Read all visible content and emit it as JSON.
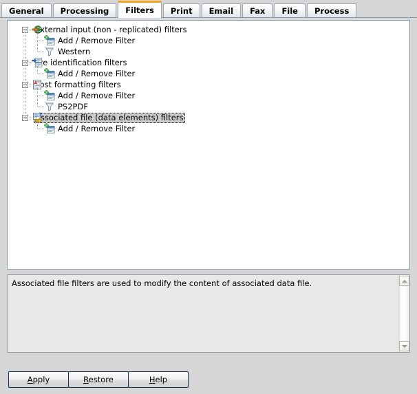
{
  "tabs": [
    {
      "label": "General",
      "active": false
    },
    {
      "label": "Processing",
      "active": false
    },
    {
      "label": "Filters",
      "active": true
    },
    {
      "label": "Print",
      "active": false
    },
    {
      "label": "Email",
      "active": false
    },
    {
      "label": "Fax",
      "active": false
    },
    {
      "label": "File",
      "active": false
    },
    {
      "label": "Process",
      "active": false
    }
  ],
  "tree": {
    "rows": [
      {
        "label": "External input (non - replicated) filters",
        "level": 0,
        "icon": "globe-arrow-icon",
        "expanded": true,
        "selected": false
      },
      {
        "label": "Add / Remove Filter",
        "level": 1,
        "icon": "add-filter-icon",
        "expanded": false,
        "selected": false
      },
      {
        "label": "Western",
        "level": 1,
        "icon": "funnel-icon",
        "expanded": false,
        "selected": false
      },
      {
        "label": "Pre identification filters",
        "level": 0,
        "icon": "pre-ident-icon",
        "expanded": true,
        "selected": false
      },
      {
        "label": "Add / Remove Filter",
        "level": 1,
        "icon": "add-filter-icon",
        "expanded": false,
        "selected": false
      },
      {
        "label": "Post formatting filters",
        "level": 0,
        "icon": "post-format-icon",
        "expanded": true,
        "selected": false
      },
      {
        "label": "Add / Remove Filter",
        "level": 1,
        "icon": "add-filter-icon",
        "expanded": false,
        "selected": false
      },
      {
        "label": "PS2PDF",
        "level": 1,
        "icon": "funnel-icon",
        "expanded": false,
        "selected": false
      },
      {
        "label": "Associated file (data elements) filters",
        "level": 0,
        "icon": "associated-file-icon",
        "expanded": true,
        "selected": true
      },
      {
        "label": "Add / Remove Filter",
        "level": 1,
        "icon": "add-filter-icon",
        "expanded": false,
        "selected": false
      }
    ]
  },
  "description": {
    "text": "Associated file filters are used to modify the content of associated data file."
  },
  "buttons": {
    "apply": {
      "prefix": "",
      "mnemonic": "A",
      "suffix": "pply"
    },
    "restore": {
      "prefix": "",
      "mnemonic": "R",
      "suffix": "estore"
    },
    "help": {
      "prefix": "",
      "mnemonic": "H",
      "suffix": "elp"
    }
  },
  "colors": {
    "active_tab_accent": "#f5a623",
    "selection_bg": "#cccccc",
    "panel_border": "#7f9db9",
    "window_bg": "#d6d6d6"
  }
}
